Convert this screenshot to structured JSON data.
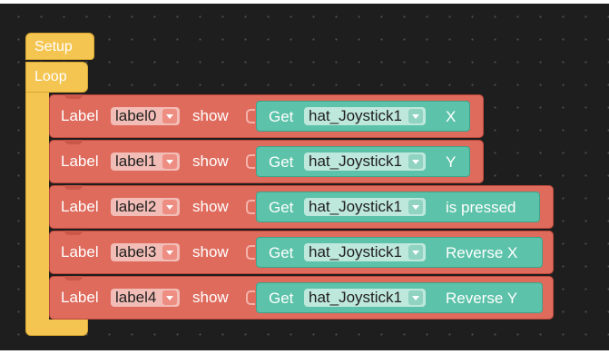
{
  "workspace": {
    "setup_label": "Setup",
    "loop_label": "Loop"
  },
  "rows": [
    {
      "label_text": "Label",
      "label_value": "label0",
      "show_text": "show",
      "get_text": "Get",
      "source_value": "hat_Joystick1",
      "property": "X"
    },
    {
      "label_text": "Label",
      "label_value": "label1",
      "show_text": "show",
      "get_text": "Get",
      "source_value": "hat_Joystick1",
      "property": "Y"
    },
    {
      "label_text": "Label",
      "label_value": "label2",
      "show_text": "show",
      "get_text": "Get",
      "source_value": "hat_Joystick1",
      "property": "is pressed"
    },
    {
      "label_text": "Label",
      "label_value": "label3",
      "show_text": "show",
      "get_text": "Get",
      "source_value": "hat_Joystick1",
      "property": "Reverse X"
    },
    {
      "label_text": "Label",
      "label_value": "label4",
      "show_text": "show",
      "get_text": "Get",
      "source_value": "hat_Joystick1",
      "property": "Reverse Y"
    }
  ],
  "colors": {
    "workspace_bg": "#1e1e1e",
    "event_block": "#f5c551",
    "label_block": "#df6b5d",
    "get_block": "#5cc2a9"
  },
  "icons": {
    "dropdown": "chevron-down-icon"
  }
}
